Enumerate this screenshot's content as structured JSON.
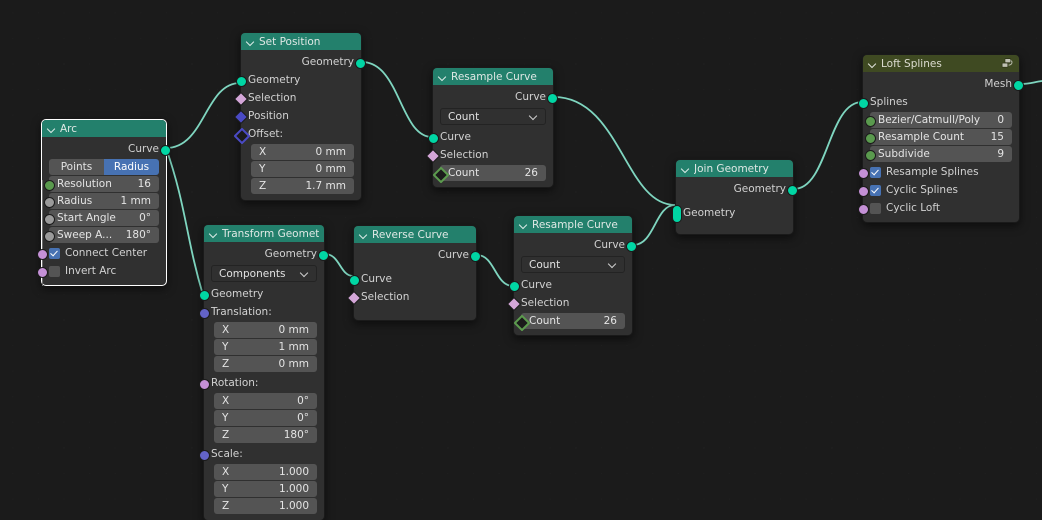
{
  "editor": {
    "name": "Geometry Node Editor",
    "background": "#1b1b1b",
    "noodle_color": "#7fd6c0"
  },
  "nodes": [
    {
      "id": "arc",
      "title": "Arc",
      "header_color": "#23806c",
      "selected": true,
      "outputs": [
        {
          "label": "Curve",
          "socket": "geometry"
        }
      ],
      "mode_toggle": {
        "options": [
          "Points",
          "Radius"
        ],
        "selected": "Radius"
      },
      "fields": [
        {
          "name": "Resolution",
          "value": "16"
        },
        {
          "name": "Radius",
          "value": "1 mm"
        },
        {
          "name": "Start Angle",
          "value": "0°"
        },
        {
          "name": "Sweep A...",
          "value": "180°"
        }
      ],
      "checkboxes": [
        {
          "label": "Connect Center",
          "checked": true
        },
        {
          "label": "Invert Arc",
          "checked": false
        }
      ]
    },
    {
      "id": "set-position",
      "title": "Set Position",
      "header_color": "#23806c",
      "selected": false,
      "outputs": [
        {
          "label": "Geometry",
          "socket": "geometry"
        }
      ],
      "inputs": [
        {
          "label": "Geometry",
          "socket": "geometry"
        },
        {
          "label": "Selection",
          "socket": "bool-field"
        },
        {
          "label": "Position",
          "socket": "vector"
        },
        {
          "label": "Offset:",
          "socket": "vector-field"
        }
      ],
      "vector_fields": [
        {
          "name": "X",
          "value": "0 mm"
        },
        {
          "name": "Y",
          "value": "0 mm"
        },
        {
          "name": "Z",
          "value": "1.7 mm"
        }
      ]
    },
    {
      "id": "resample-curve-top",
      "title": "Resample Curve",
      "header_color": "#23806c",
      "selected": false,
      "outputs": [
        {
          "label": "Curve",
          "socket": "geometry"
        }
      ],
      "mode": {
        "value": "Count"
      },
      "inputs": [
        {
          "label": "Curve",
          "socket": "geometry"
        },
        {
          "label": "Selection",
          "socket": "bool-field"
        }
      ],
      "fields": [
        {
          "name": "Count",
          "value": "26"
        }
      ]
    },
    {
      "id": "transform-geometry",
      "title": "Transform Geometry",
      "header_color": "#23806c",
      "selected": false,
      "outputs": [
        {
          "label": "Geometry",
          "socket": "geometry"
        }
      ],
      "mode": {
        "value": "Components"
      },
      "inputs": [
        {
          "label": "Geometry",
          "socket": "geometry"
        }
      ],
      "translation": {
        "label": "Translation:",
        "values": [
          {
            "name": "X",
            "value": "0 mm"
          },
          {
            "name": "Y",
            "value": "1 mm"
          },
          {
            "name": "Z",
            "value": "0 mm"
          }
        ]
      },
      "rotation": {
        "label": "Rotation:",
        "values": [
          {
            "name": "X",
            "value": "0°"
          },
          {
            "name": "Y",
            "value": "0°"
          },
          {
            "name": "Z",
            "value": "180°"
          }
        ]
      },
      "scale": {
        "label": "Scale:",
        "values": [
          {
            "name": "X",
            "value": "1.000"
          },
          {
            "name": "Y",
            "value": "1.000"
          },
          {
            "name": "Z",
            "value": "1.000"
          }
        ]
      }
    },
    {
      "id": "reverse-curve",
      "title": "Reverse Curve",
      "header_color": "#23806c",
      "selected": false,
      "outputs": [
        {
          "label": "Curve",
          "socket": "geometry"
        }
      ],
      "inputs": [
        {
          "label": "Curve",
          "socket": "geometry"
        },
        {
          "label": "Selection",
          "socket": "bool-field"
        }
      ]
    },
    {
      "id": "resample-curve-bottom",
      "title": "Resample Curve",
      "header_color": "#23806c",
      "selected": false,
      "outputs": [
        {
          "label": "Curve",
          "socket": "geometry"
        }
      ],
      "mode": {
        "value": "Count"
      },
      "inputs": [
        {
          "label": "Curve",
          "socket": "geometry"
        },
        {
          "label": "Selection",
          "socket": "bool-field"
        }
      ],
      "fields": [
        {
          "name": "Count",
          "value": "26"
        }
      ]
    },
    {
      "id": "join-geometry",
      "title": "Join Geometry",
      "header_color": "#23806c",
      "selected": false,
      "outputs": [
        {
          "label": "Geometry",
          "socket": "geometry"
        }
      ],
      "inputs": [
        {
          "label": "Geometry",
          "socket": "geometry-multi"
        }
      ]
    },
    {
      "id": "loft-splines",
      "title": "Loft Splines",
      "header_color": "#3f4a22",
      "icon": "node-group-icon",
      "selected": false,
      "outputs": [
        {
          "label": "Mesh",
          "socket": "geometry"
        }
      ],
      "inputs": [
        {
          "label": "Splines",
          "socket": "geometry"
        }
      ],
      "fields": [
        {
          "name": "Bezier/Catmull/Poly",
          "value": "0"
        },
        {
          "name": "Resample Count",
          "value": "15"
        },
        {
          "name": "Subdivide",
          "value": "9"
        }
      ],
      "checkboxes": [
        {
          "label": "Resample Splines",
          "checked": true
        },
        {
          "label": "Cyclic Splines",
          "checked": true
        },
        {
          "label": "Cyclic Loft",
          "checked": false
        }
      ]
    }
  ]
}
